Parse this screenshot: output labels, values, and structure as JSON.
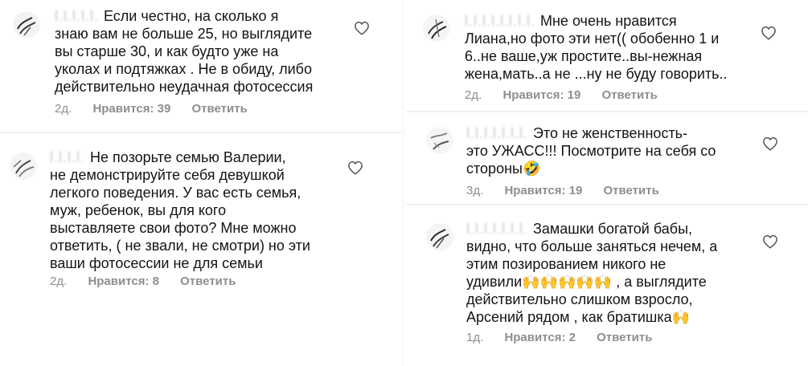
{
  "comments": [
    {
      "username": "l.l.l.l.l.",
      "lines": [
        "Если честно, на сколько я",
        "знаю вам не больше 25, но выглядите",
        "вы старше 30, и как будто уже на",
        "уколах и подтяжках . Не в обиду, либо",
        "действительно неудачная фотосессия"
      ],
      "time": "2д.",
      "likes": "Нравится: 39",
      "reply": "Ответить"
    },
    {
      "username": "l.l.l.l.",
      "lines": [
        "Не позорьте семью Валерии,",
        "не демонстрируйте себя девушкой",
        "легкого поведения. У вас есть семья,",
        "муж, ребенок, вы для кого",
        "выставляете свои фото? Мне можно",
        "ответить, ( не звали, не смотри) но эти",
        "ваши фотосессии не для семьи"
      ],
      "time": "2д.",
      "likes": "Нравится: 8",
      "reply": "Ответить"
    },
    {
      "username": "l.l.l.l.l.l.l.l.",
      "lines": [
        "Мне очень нравится",
        "Лиана,но фото эти нет(( обобенно 1 и",
        "6..не ваше,уж простите..вы-нежная",
        "жена,мать..а не ...ну не буду говорить.."
      ],
      "time": "2д.",
      "likes": "Нравится: 19",
      "reply": "Ответить"
    },
    {
      "username": "l.l.l.l.l.l.l.",
      "lines": [
        "Это не женственность-",
        "это УЖАСС!!! Посмотрите на себя со",
        "стороны🤣"
      ],
      "time": "3д.",
      "likes": "Нравится: 19",
      "reply": "Ответить"
    },
    {
      "username": "l.l.l.l.l.l.l.",
      "lines": [
        "Замашки богатой бабы,",
        "видно, что больше заняться нечем, а",
        "этим  позированием никого не",
        "удивили🙌🙌🙌🙌🙌 , а выглядите",
        "действительно слишком взросло,",
        "Арсений рядом , как братишка🙌"
      ],
      "time": "1д.",
      "likes": "Нравится: 2",
      "reply": "Ответить"
    }
  ]
}
